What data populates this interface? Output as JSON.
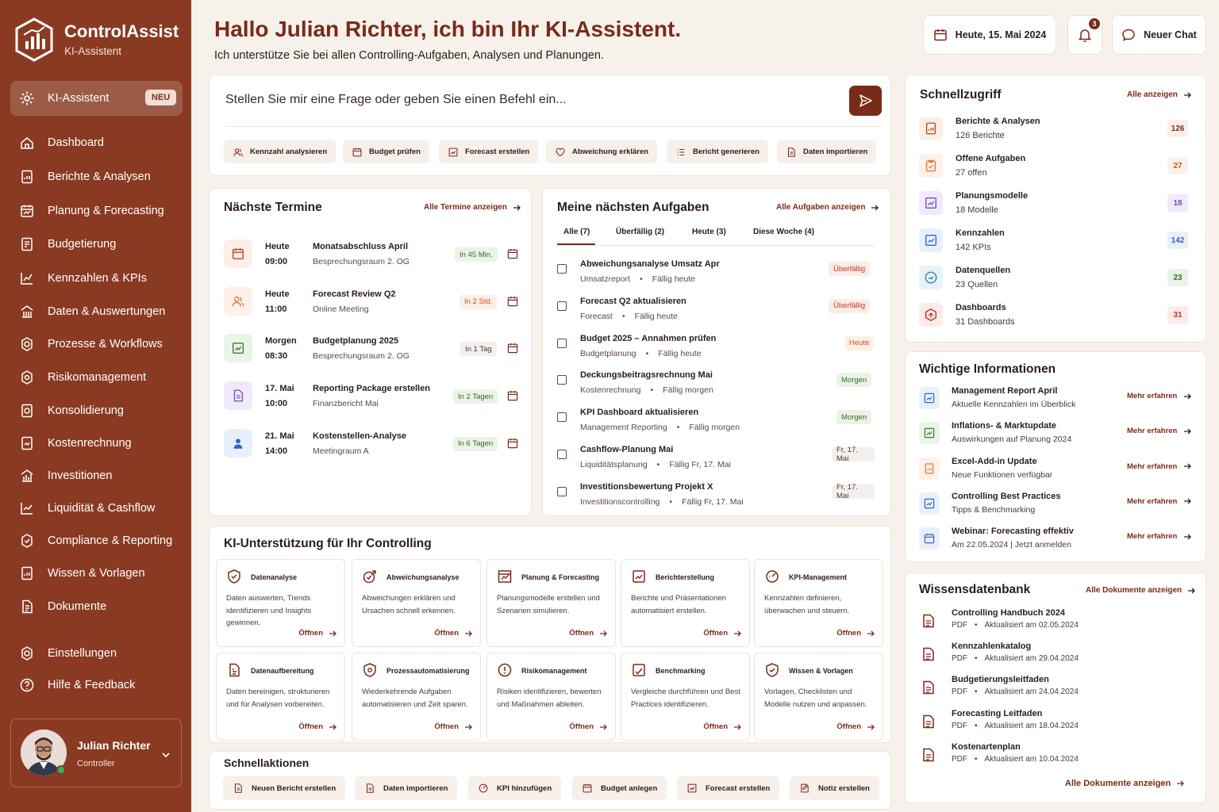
{
  "brand": {
    "title": "ControlAssist",
    "subtitle": "KI-Assistent"
  },
  "sidebar": {
    "active": {
      "label": "KI-Assistent",
      "badge": "NEU"
    },
    "items": [
      {
        "label": "Dashboard",
        "icon": "home-icon"
      },
      {
        "label": "Berichte & Analysen",
        "icon": "report-icon"
      },
      {
        "label": "Planung & Forecasting",
        "icon": "planning-icon"
      },
      {
        "label": "Budgetierung",
        "icon": "budget-icon"
      },
      {
        "label": "Kennzahlen & KPIs",
        "icon": "kpi-icon"
      },
      {
        "label": "Daten & Auswertungen",
        "icon": "data-icon"
      },
      {
        "label": "Prozesse & Workflows",
        "icon": "workflow-icon"
      },
      {
        "label": "Risikomanagement",
        "icon": "risk-icon"
      },
      {
        "label": "Konsolidierung",
        "icon": "consolidation-icon"
      },
      {
        "label": "Kostenrechnung",
        "icon": "cost-icon"
      },
      {
        "label": "Investitionen",
        "icon": "investment-icon"
      },
      {
        "label": "Liquidität & Cashflow",
        "icon": "cashflow-icon"
      },
      {
        "label": "Compliance & Reporting",
        "icon": "compliance-icon"
      },
      {
        "label": "Wissen & Vorlagen",
        "icon": "knowledge-icon"
      },
      {
        "label": "Dokumente",
        "icon": "documents-icon"
      }
    ],
    "bottom": [
      {
        "label": "Einstellungen",
        "icon": "gear-icon"
      },
      {
        "label": "Hilfe & Feedback",
        "icon": "help-icon"
      }
    ],
    "user": {
      "name": "Julian Richter",
      "role": "Controller"
    }
  },
  "header": {
    "greeting": "Hallo Julian Richter, ich bin Ihr KI-Assistent.",
    "subtitle": "Ich unterstütze Sie bei allen Controlling-Aufgaben, Analysen und Planungen.",
    "date": "Heute, 15. Mai 2024",
    "notifications": "3",
    "new_chat": "Neuer Chat"
  },
  "ask": {
    "placeholder": "Stellen Sie mir eine Frage oder geben Sie einen Befehl ein...",
    "chips": [
      "Kennzahl analysieren",
      "Budget prüfen",
      "Forecast erstellen",
      "Abweichung erklären",
      "Bericht generieren",
      "Daten importieren"
    ]
  },
  "termine": {
    "title": "Nächste Termine",
    "link": "Alle Termine anzeigen",
    "items": [
      {
        "day": "Heute",
        "time": "09:00",
        "title": "Monatsabschluss April",
        "location": "Besprechungsraum 2. OG",
        "pill": "In 45 Min."
      },
      {
        "day": "Heute",
        "time": "11:00",
        "title": "Forecast Review Q2",
        "location": "Online Meeting",
        "pill": "In 2 Std."
      },
      {
        "day": "Morgen",
        "time": "08:30",
        "title": "Budgetplanung 2025",
        "location": "Besprechungsraum 2. OG",
        "pill": "In 1 Tag"
      },
      {
        "day": "17. Mai",
        "time": "10:00",
        "title": "Reporting Package erstellen",
        "location": "Finanzbericht Mai",
        "pill": "In 2 Tagen"
      },
      {
        "day": "21. Mai",
        "time": "14:00",
        "title": "Kostenstellen-Analyse",
        "location": "Meetingraum A",
        "pill": "In 6 Tagen"
      }
    ]
  },
  "aufgaben": {
    "title": "Meine nächsten Aufgaben",
    "link": "Alle Aufgaben anzeigen",
    "tabs": [
      "Alle (7)",
      "Überfällig (2)",
      "Heute (3)",
      "Diese Woche (4)"
    ],
    "items": [
      {
        "title": "Abweichungsanalyse Umsatz Apr",
        "category": "Umsatzreport",
        "due": "Fällig heute",
        "pill": "Überfällig"
      },
      {
        "title": "Forecast Q2 aktualisieren",
        "category": "Forecast",
        "due": "Fällig heute",
        "pill": "Überfällig"
      },
      {
        "title": "Budget 2025 – Annahmen prüfen",
        "category": "Budgetplanung",
        "due": "Fällig heute",
        "pill": "Heute"
      },
      {
        "title": "Deckungsbeitragsrechnung Mai",
        "category": "Kostenrechnung",
        "due": "Fällig morgen",
        "pill": "Morgen"
      },
      {
        "title": "KPI Dashboard aktualisieren",
        "category": "Management Reporting",
        "due": "Fällig morgen",
        "pill": "Morgen"
      },
      {
        "title": "Cashflow-Planung Mai",
        "category": "Liquiditätsplanung",
        "due": "Fällig Fr, 17. Mai",
        "pill": "Fr, 17. Mai"
      },
      {
        "title": "Investitionsbewertung Projekt X",
        "category": "Investitionscontrolling",
        "due": "Fällig Fr, 17. Mai",
        "pill": "Fr, 17. Mai"
      }
    ]
  },
  "ki": {
    "title": "KI-Unterstützung für Ihr Controlling",
    "open_label": "Öffnen",
    "items": [
      {
        "title": "Datenanalyse",
        "desc": "Daten auswerten, Trends identifizieren und Insights gewinnen."
      },
      {
        "title": "Abweichungsanalyse",
        "desc": "Abweichungen erklären und Ursachen schnell erkennen."
      },
      {
        "title": "Planung & Forecasting",
        "desc": "Planungsmodelle erstellen und Szenarien simulieren."
      },
      {
        "title": "Berichterstellung",
        "desc": "Berichte und Präsentationen automatisiert erstellen."
      },
      {
        "title": "KPI-Management",
        "desc": "Kennzahlen definieren, überwachen und steuern."
      },
      {
        "title": "Datenaufbereitung",
        "desc": "Daten bereinigen, strukturieren und für Analysen vorbereiten."
      },
      {
        "title": "Prozessautomatisierung",
        "desc": "Wiederkehrende Aufgaben automatisieren und Zeit sparen."
      },
      {
        "title": "Risikomanagement",
        "desc": "Risiken identifizieren, bewerten und Maßnahmen ableiten."
      },
      {
        "title": "Benchmarking",
        "desc": "Vergleiche durchführen und Best Practices identifizieren."
      },
      {
        "title": "Wissen & Vorlagen",
        "desc": "Vorlagen, Checklisten und Modelle nutzen und anpassen."
      }
    ]
  },
  "schnellaktionen": {
    "title": "Schnellaktionen",
    "items": [
      "Neuen Bericht erstellen",
      "Daten importieren",
      "KPI hinzufügen",
      "Budget anlegen",
      "Forecast erstellen",
      "Notiz erstellen"
    ]
  },
  "schnellzugriff": {
    "title": "Schnellzugriff",
    "link": "Alle anzeigen",
    "items": [
      {
        "title": "Berichte & Analysen",
        "sub": "126 Berichte",
        "count": "126"
      },
      {
        "title": "Offene Aufgaben",
        "sub": "27 offen",
        "count": "27"
      },
      {
        "title": "Planungsmodelle",
        "sub": "18 Modelle",
        "count": "18"
      },
      {
        "title": "Kennzahlen",
        "sub": "142 KPIs",
        "count": "142"
      },
      {
        "title": "Datenquellen",
        "sub": "23 Quellen",
        "count": "23"
      },
      {
        "title": "Dashboards",
        "sub": "31 Dashboards",
        "count": "31"
      }
    ]
  },
  "infos": {
    "title": "Wichtige Informationen",
    "link_label": "Mehr erfahren",
    "items": [
      {
        "title": "Management Report April",
        "sub": "Aktuelle Kennzahlen im Überblick"
      },
      {
        "title": "Inflations- & Marktupdate",
        "sub": "Auswirkungen auf Planung 2024"
      },
      {
        "title": "Excel-Add-in Update",
        "sub": "Neue Funktionen verfügbar"
      },
      {
        "title": "Controlling Best Practices",
        "sub": "Tipps & Benchmarking"
      },
      {
        "title": "Webinar: Forecasting effektiv",
        "sub": "Am 22.05.2024 | Jetzt anmelden"
      }
    ]
  },
  "wissen": {
    "title": "Wissensdatenbank",
    "link": "Alle Dokumente anzeigen",
    "footer_link": "Alle Dokumente anzeigen",
    "items": [
      {
        "title": "Controlling Handbuch 2024",
        "type": "PDF",
        "updated": "Aktualisiert am 02.05.2024"
      },
      {
        "title": "Kennzahlenkatalog",
        "type": "PDF",
        "updated": "Aktualisiert am 29.04.2024"
      },
      {
        "title": "Budgetierungsleitfaden",
        "type": "PDF",
        "updated": "Aktualisiert am 24.04.2024"
      },
      {
        "title": "Forecasting Leitfaden",
        "type": "PDF",
        "updated": "Aktualisiert am 18.04.2024"
      },
      {
        "title": "Kostenartenplan",
        "type": "PDF",
        "updated": "Aktualisiert am 10.04.2024"
      }
    ]
  },
  "colors": {
    "brand": "#8a3a22",
    "accent": "#7a2b17",
    "success": "#2dbb53",
    "danger": "#c03a1f"
  }
}
